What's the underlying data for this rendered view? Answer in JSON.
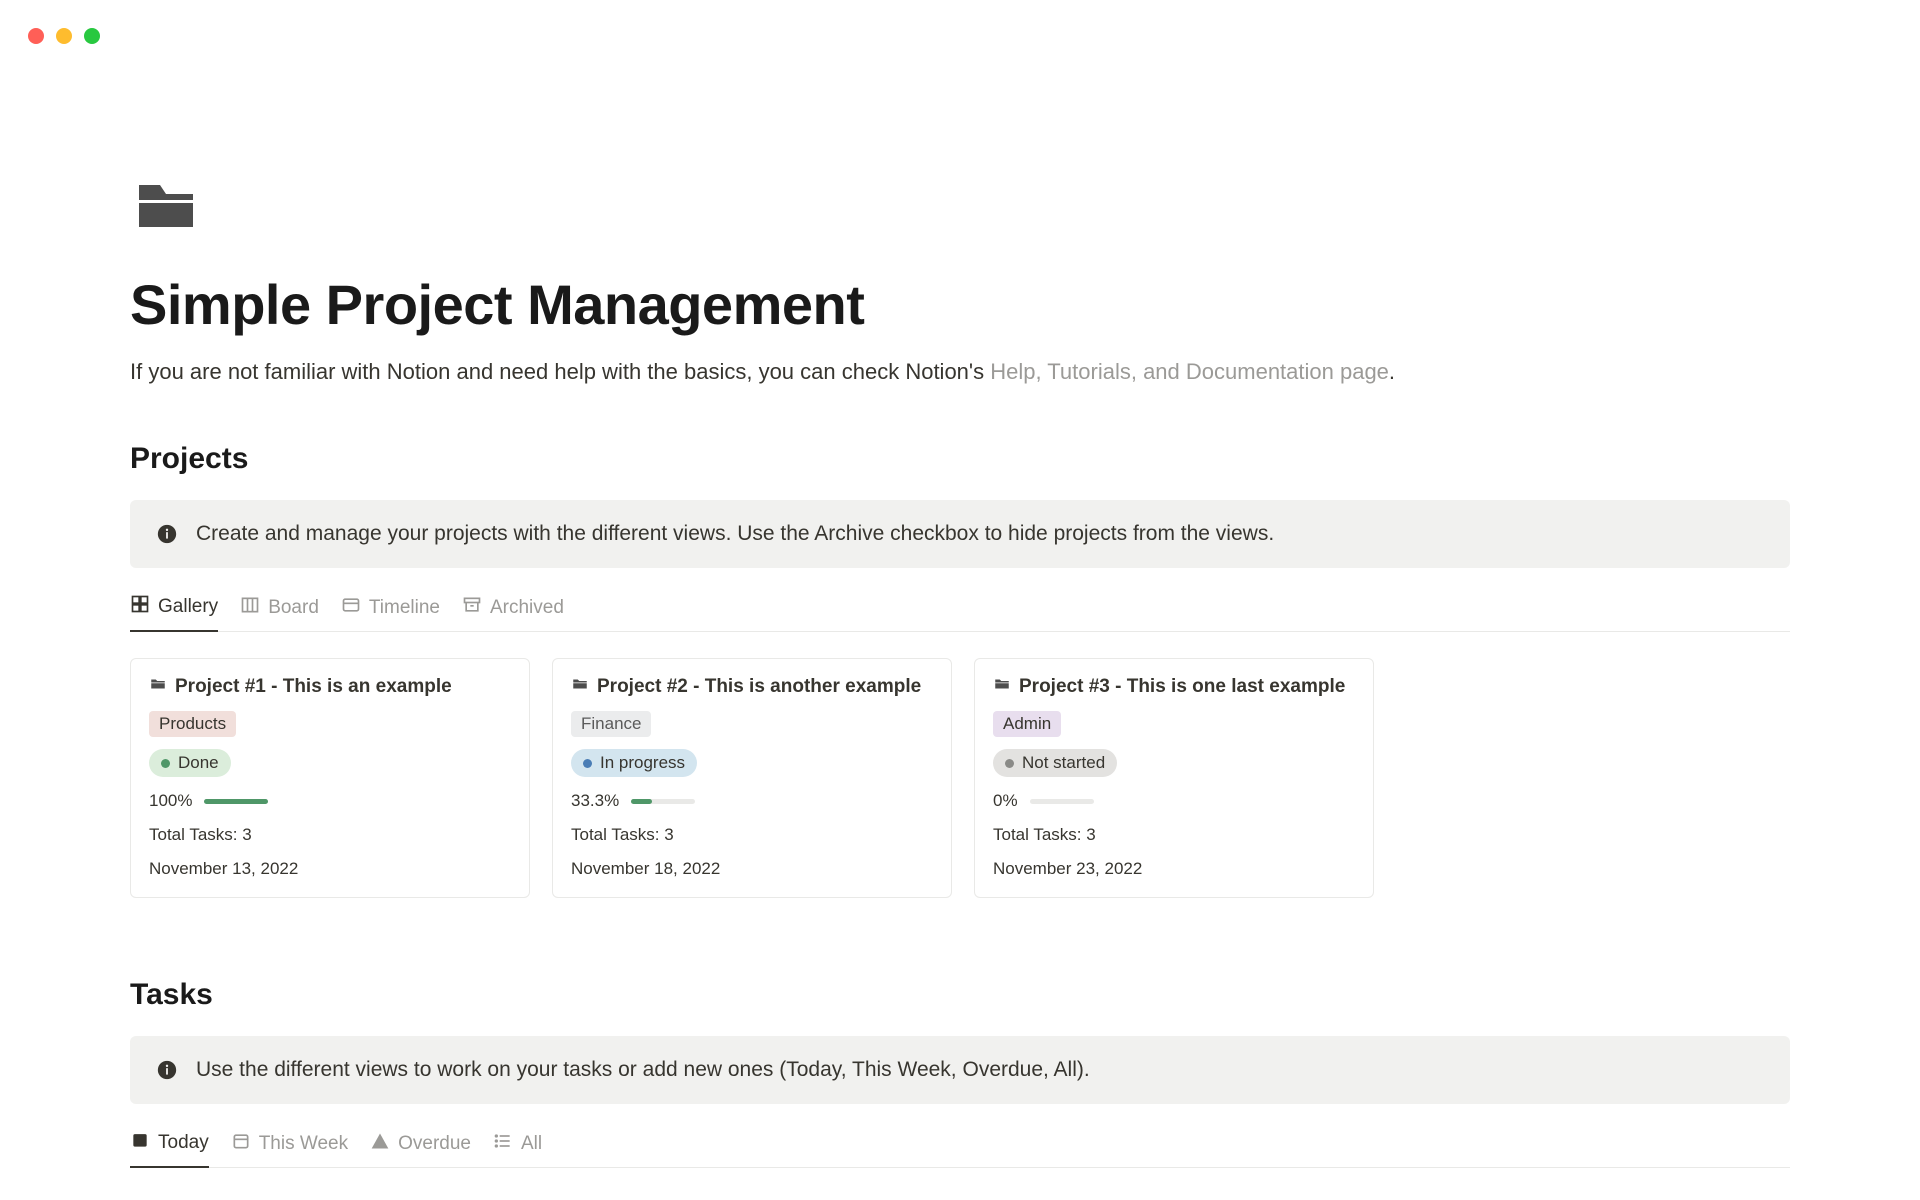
{
  "page": {
    "title": "Simple Project Management",
    "subtitle_prefix": "If you are not familiar with Notion and need help with the basics, you can check Notion's ",
    "subtitle_link": "Help, Tutorials, and Documentation page",
    "subtitle_suffix": "."
  },
  "projects": {
    "heading": "Projects",
    "callout": "Create and manage your projects with the different views. Use the Archive checkbox to hide projects from the views.",
    "tabs": [
      {
        "label": "Gallery",
        "active": true
      },
      {
        "label": "Board",
        "active": false
      },
      {
        "label": "Timeline",
        "active": false
      },
      {
        "label": "Archived",
        "active": false
      }
    ],
    "cards": [
      {
        "title": "Project #1 - This is an example",
        "tag": "Products",
        "tag_class": "tag-products",
        "status": "Done",
        "status_class": "status-done",
        "progress_label": "100%",
        "progress_pct": 100,
        "total_tasks": "Total Tasks: 3",
        "date": "November 13, 2022"
      },
      {
        "title": "Project #2 - This is another example",
        "tag": "Finance",
        "tag_class": "tag-finance",
        "status": "In progress",
        "status_class": "status-progress",
        "progress_label": "33.3%",
        "progress_pct": 33,
        "total_tasks": "Total Tasks: 3",
        "date": "November 18, 2022"
      },
      {
        "title": "Project #3 - This is one last example",
        "tag": "Admin",
        "tag_class": "tag-admin",
        "status": "Not started",
        "status_class": "status-notstarted",
        "progress_label": "0%",
        "progress_pct": 0,
        "total_tasks": "Total Tasks: 3",
        "date": "November 23, 2022"
      }
    ]
  },
  "tasks": {
    "heading": "Tasks",
    "callout": "Use the different views to work on your tasks or add new ones (Today, This Week, Overdue, All).",
    "tabs": [
      {
        "label": "Today",
        "active": true
      },
      {
        "label": "This Week",
        "active": false
      },
      {
        "label": "Overdue",
        "active": false
      },
      {
        "label": "All",
        "active": false
      }
    ]
  }
}
